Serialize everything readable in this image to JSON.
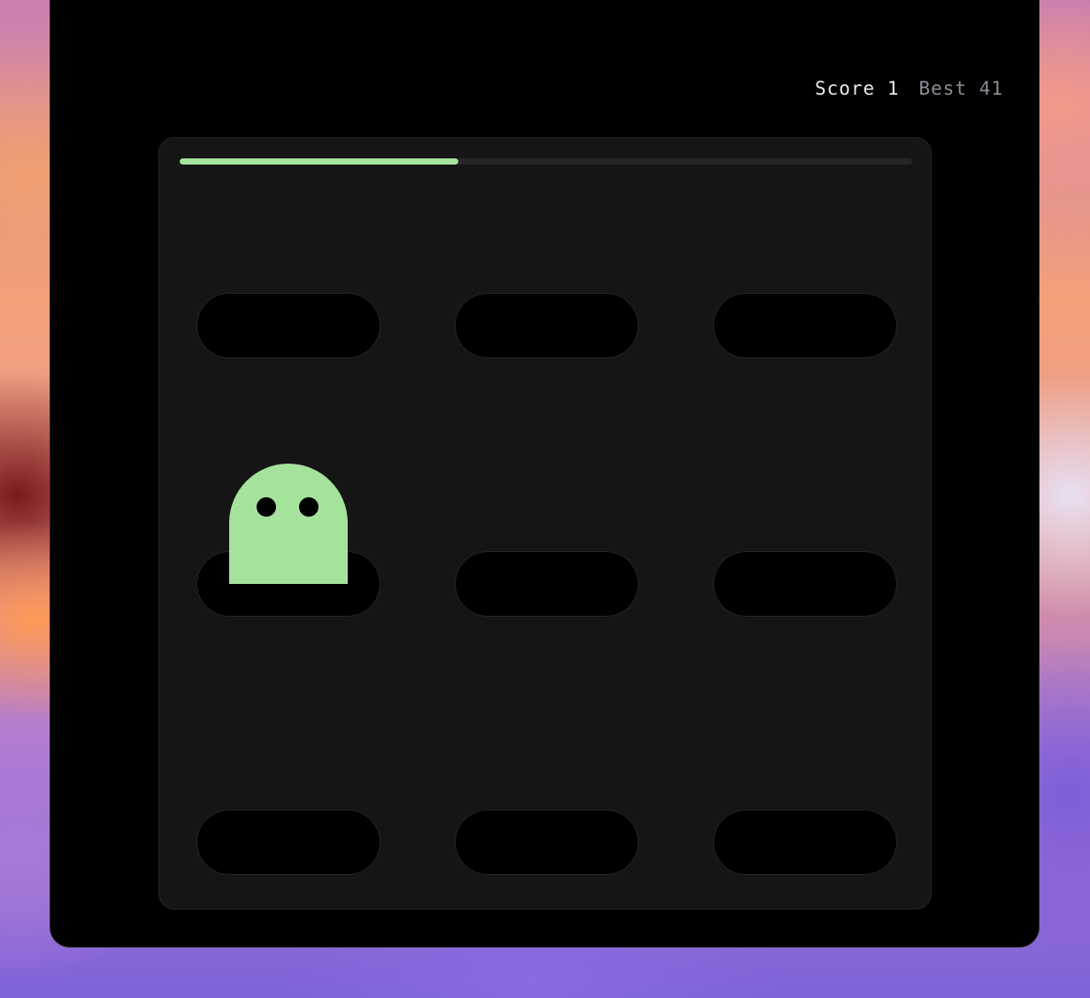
{
  "hud": {
    "score_label": "Score",
    "score_value": "1",
    "best_label": "Best",
    "best_value": "41"
  },
  "timer": {
    "remaining_fraction": 0.38
  },
  "holes": [
    {
      "row": 0,
      "col": 0,
      "mole": false
    },
    {
      "row": 0,
      "col": 1,
      "mole": false
    },
    {
      "row": 0,
      "col": 2,
      "mole": false
    },
    {
      "row": 1,
      "col": 0,
      "mole": true
    },
    {
      "row": 1,
      "col": 1,
      "mole": false
    },
    {
      "row": 1,
      "col": 2,
      "mole": false
    },
    {
      "row": 2,
      "col": 0,
      "mole": false
    },
    {
      "row": 2,
      "col": 1,
      "mole": false
    },
    {
      "row": 2,
      "col": 2,
      "mole": false
    }
  ],
  "colors": {
    "mole": "#a5e29c",
    "progress": "#a5e29c",
    "board": "#151515",
    "hole": "#000000"
  }
}
